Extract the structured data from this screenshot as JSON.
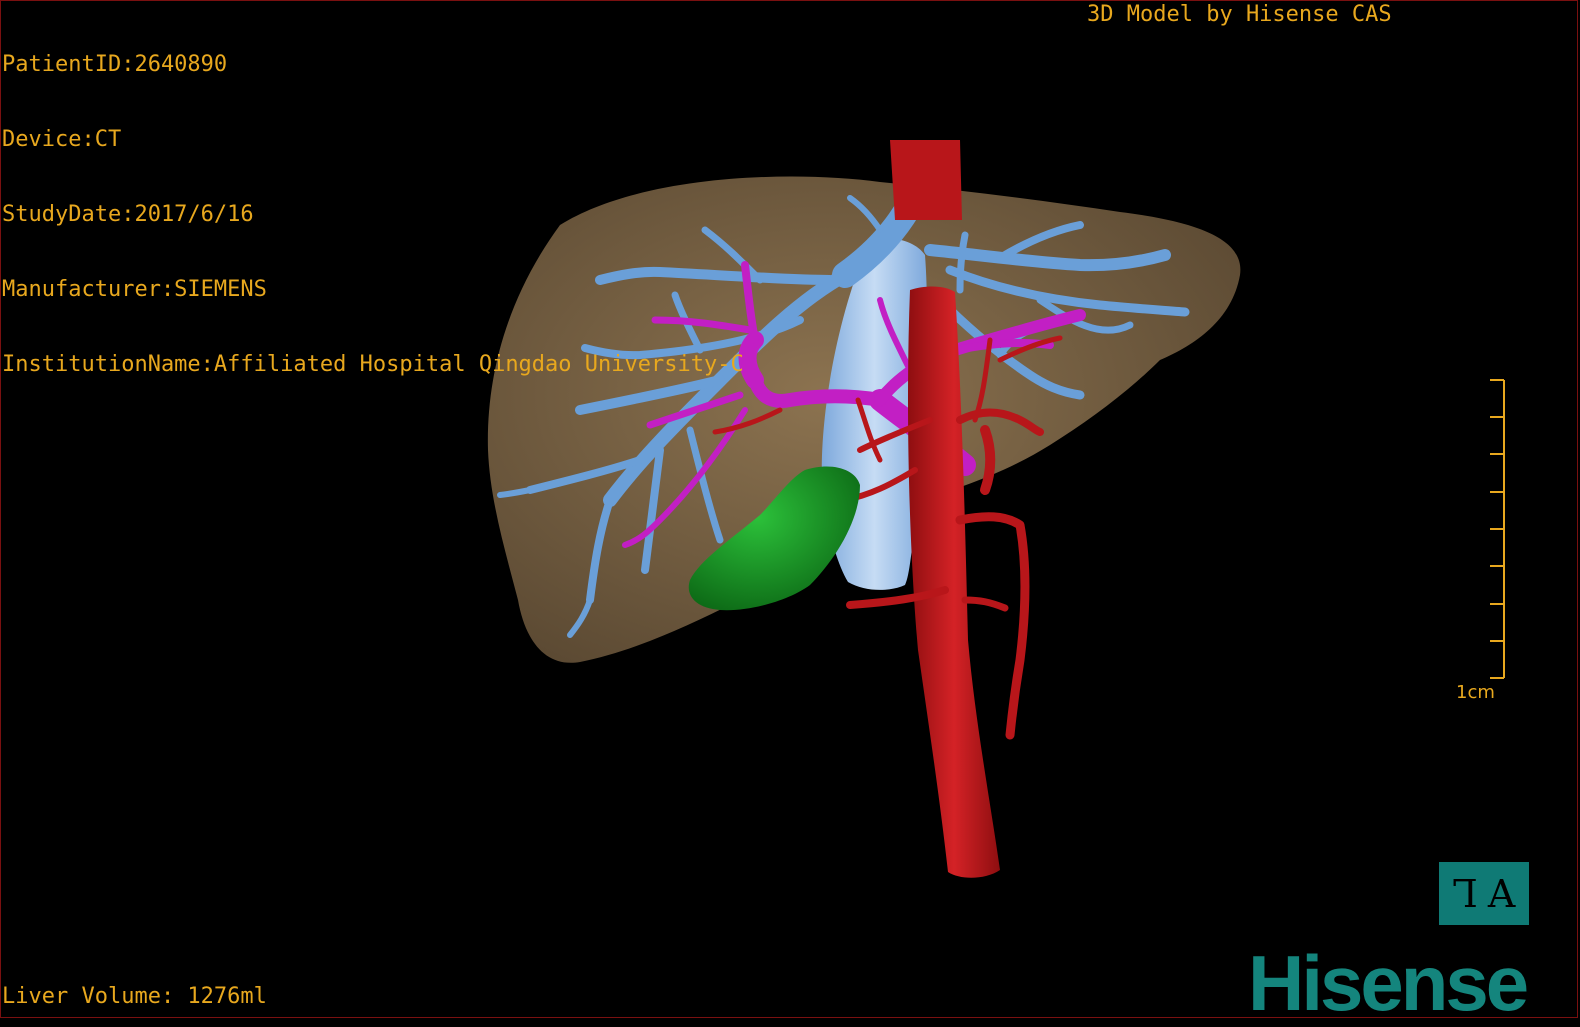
{
  "overlay": {
    "patient_id": "PatientID:2640890",
    "device": "Device:CT",
    "study_date": "StudyDate:2017/6/16",
    "manufacturer": "Manufacturer:SIEMENS",
    "institution": "InstitutionName:Affiliated Hospital Qingdao University-C",
    "model_credit": "3D Model by Hisense CAS",
    "liver_volume": "Liver Volume: 1276ml"
  },
  "scale_bar": {
    "label": "1cm"
  },
  "view_button": {
    "left_glyph": "Ꞁ",
    "right_glyph": "A"
  },
  "logo": {
    "text": "Hisense"
  },
  "colors": {
    "text": "#e8a81e",
    "liver": "#7a6446",
    "hepatic_vein": "#6a9fd8",
    "ivc": "#a9c8ec",
    "portal_vein": "#c21fc4",
    "artery": "#b8161a",
    "gallbladder": "#1a9a25",
    "brand": "#14857d"
  }
}
